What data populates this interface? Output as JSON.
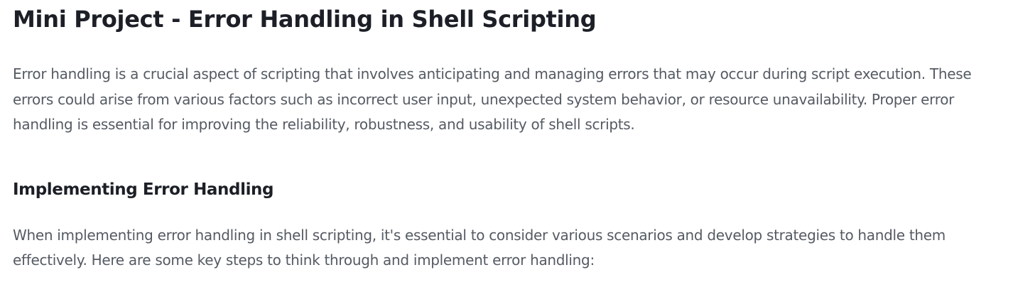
{
  "article": {
    "title": "Mini Project - Error Handling in Shell Scripting",
    "intro": "Error handling is a crucial aspect of scripting that involves anticipating and managing errors that may occur during script execution. These errors could arise from various factors such as incorrect user input, unexpected system behavior, or resource unavailability. Proper error handling is essential for improving the reliability, robustness, and usability of shell scripts.",
    "section_heading": "Implementing Error Handling",
    "section_text": "When implementing error handling in shell scripting, it's essential to consider various scenarios and develop strategies to handle them effectively. Here are some key steps to think through and implement error handling:"
  }
}
